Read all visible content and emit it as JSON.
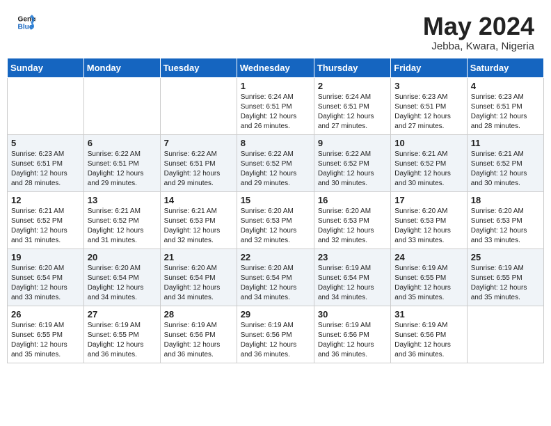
{
  "header": {
    "logo_line1": "General",
    "logo_line2": "Blue",
    "month_year": "May 2024",
    "location": "Jebba, Kwara, Nigeria"
  },
  "days_of_week": [
    "Sunday",
    "Monday",
    "Tuesday",
    "Wednesday",
    "Thursday",
    "Friday",
    "Saturday"
  ],
  "weeks": [
    [
      {
        "day": "",
        "info": ""
      },
      {
        "day": "",
        "info": ""
      },
      {
        "day": "",
        "info": ""
      },
      {
        "day": "1",
        "info": "Sunrise: 6:24 AM\nSunset: 6:51 PM\nDaylight: 12 hours\nand 26 minutes."
      },
      {
        "day": "2",
        "info": "Sunrise: 6:24 AM\nSunset: 6:51 PM\nDaylight: 12 hours\nand 27 minutes."
      },
      {
        "day": "3",
        "info": "Sunrise: 6:23 AM\nSunset: 6:51 PM\nDaylight: 12 hours\nand 27 minutes."
      },
      {
        "day": "4",
        "info": "Sunrise: 6:23 AM\nSunset: 6:51 PM\nDaylight: 12 hours\nand 28 minutes."
      }
    ],
    [
      {
        "day": "5",
        "info": "Sunrise: 6:23 AM\nSunset: 6:51 PM\nDaylight: 12 hours\nand 28 minutes."
      },
      {
        "day": "6",
        "info": "Sunrise: 6:22 AM\nSunset: 6:51 PM\nDaylight: 12 hours\nand 29 minutes."
      },
      {
        "day": "7",
        "info": "Sunrise: 6:22 AM\nSunset: 6:51 PM\nDaylight: 12 hours\nand 29 minutes."
      },
      {
        "day": "8",
        "info": "Sunrise: 6:22 AM\nSunset: 6:52 PM\nDaylight: 12 hours\nand 29 minutes."
      },
      {
        "day": "9",
        "info": "Sunrise: 6:22 AM\nSunset: 6:52 PM\nDaylight: 12 hours\nand 30 minutes."
      },
      {
        "day": "10",
        "info": "Sunrise: 6:21 AM\nSunset: 6:52 PM\nDaylight: 12 hours\nand 30 minutes."
      },
      {
        "day": "11",
        "info": "Sunrise: 6:21 AM\nSunset: 6:52 PM\nDaylight: 12 hours\nand 30 minutes."
      }
    ],
    [
      {
        "day": "12",
        "info": "Sunrise: 6:21 AM\nSunset: 6:52 PM\nDaylight: 12 hours\nand 31 minutes."
      },
      {
        "day": "13",
        "info": "Sunrise: 6:21 AM\nSunset: 6:52 PM\nDaylight: 12 hours\nand 31 minutes."
      },
      {
        "day": "14",
        "info": "Sunrise: 6:21 AM\nSunset: 6:53 PM\nDaylight: 12 hours\nand 32 minutes."
      },
      {
        "day": "15",
        "info": "Sunrise: 6:20 AM\nSunset: 6:53 PM\nDaylight: 12 hours\nand 32 minutes."
      },
      {
        "day": "16",
        "info": "Sunrise: 6:20 AM\nSunset: 6:53 PM\nDaylight: 12 hours\nand 32 minutes."
      },
      {
        "day": "17",
        "info": "Sunrise: 6:20 AM\nSunset: 6:53 PM\nDaylight: 12 hours\nand 33 minutes."
      },
      {
        "day": "18",
        "info": "Sunrise: 6:20 AM\nSunset: 6:53 PM\nDaylight: 12 hours\nand 33 minutes."
      }
    ],
    [
      {
        "day": "19",
        "info": "Sunrise: 6:20 AM\nSunset: 6:54 PM\nDaylight: 12 hours\nand 33 minutes."
      },
      {
        "day": "20",
        "info": "Sunrise: 6:20 AM\nSunset: 6:54 PM\nDaylight: 12 hours\nand 34 minutes."
      },
      {
        "day": "21",
        "info": "Sunrise: 6:20 AM\nSunset: 6:54 PM\nDaylight: 12 hours\nand 34 minutes."
      },
      {
        "day": "22",
        "info": "Sunrise: 6:20 AM\nSunset: 6:54 PM\nDaylight: 12 hours\nand 34 minutes."
      },
      {
        "day": "23",
        "info": "Sunrise: 6:19 AM\nSunset: 6:54 PM\nDaylight: 12 hours\nand 34 minutes."
      },
      {
        "day": "24",
        "info": "Sunrise: 6:19 AM\nSunset: 6:55 PM\nDaylight: 12 hours\nand 35 minutes."
      },
      {
        "day": "25",
        "info": "Sunrise: 6:19 AM\nSunset: 6:55 PM\nDaylight: 12 hours\nand 35 minutes."
      }
    ],
    [
      {
        "day": "26",
        "info": "Sunrise: 6:19 AM\nSunset: 6:55 PM\nDaylight: 12 hours\nand 35 minutes."
      },
      {
        "day": "27",
        "info": "Sunrise: 6:19 AM\nSunset: 6:55 PM\nDaylight: 12 hours\nand 36 minutes."
      },
      {
        "day": "28",
        "info": "Sunrise: 6:19 AM\nSunset: 6:56 PM\nDaylight: 12 hours\nand 36 minutes."
      },
      {
        "day": "29",
        "info": "Sunrise: 6:19 AM\nSunset: 6:56 PM\nDaylight: 12 hours\nand 36 minutes."
      },
      {
        "day": "30",
        "info": "Sunrise: 6:19 AM\nSunset: 6:56 PM\nDaylight: 12 hours\nand 36 minutes."
      },
      {
        "day": "31",
        "info": "Sunrise: 6:19 AM\nSunset: 6:56 PM\nDaylight: 12 hours\nand 36 minutes."
      },
      {
        "day": "",
        "info": ""
      }
    ]
  ]
}
